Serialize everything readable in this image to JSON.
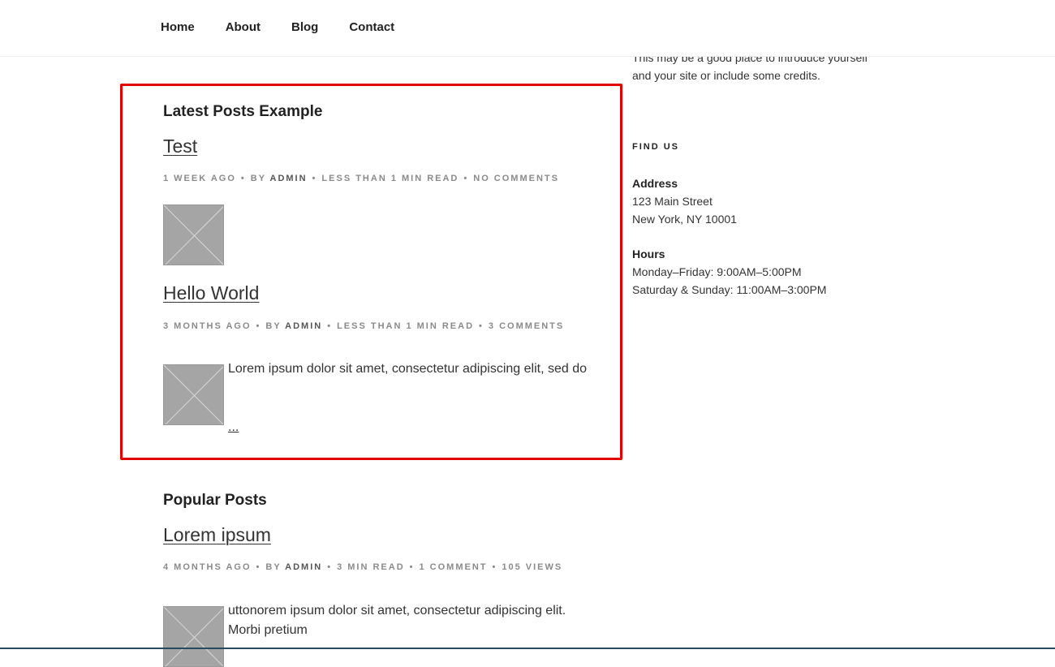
{
  "nav": {
    "items": [
      "Home",
      "About",
      "Blog",
      "Contact"
    ]
  },
  "sidebar": {
    "intro_partial": "This may be a good place to introduce yourself",
    "intro_rest": "and your site or include some credits.",
    "find_us_title": "FIND US",
    "address_label": "Address",
    "address_line1": "123 Main Street",
    "address_line2": "New York, NY 10001",
    "hours_label": "Hours",
    "hours_line1": "Monday–Friday: 9:00AM–5:00PM",
    "hours_line2": "Saturday & Sunday: 11:00AM–3:00PM"
  },
  "latest": {
    "heading": "Latest Posts Example",
    "posts": [
      {
        "title": "Test",
        "date": "1 week ago",
        "by": "by",
        "author": "admin",
        "read": "less than 1 min read",
        "comments": "No Comments"
      },
      {
        "title": "Hello World",
        "date": "3 months ago",
        "by": "by",
        "author": "admin",
        "read": "less than 1 min read",
        "comments": "3 Comments",
        "excerpt": "Lorem ipsum dolor sit amet, consectetur adipiscing elit, sed do",
        "more": "..."
      }
    ]
  },
  "popular": {
    "heading": "Popular Posts",
    "posts": [
      {
        "title": "Lorem ipsum",
        "date": "4 months ago",
        "by": "by",
        "author": "admin",
        "read": "3 min read",
        "comments": "1 Comment",
        "views": "105 Views",
        "excerpt": "uttonorem ipsum dolor sit amet, consectetur adipiscing elit. Morbi pretium"
      }
    ]
  },
  "colors": {
    "highlight_border": "#e00000",
    "meta_gray": "#8a8a8a",
    "thumb_gray": "#a5a5a5"
  }
}
